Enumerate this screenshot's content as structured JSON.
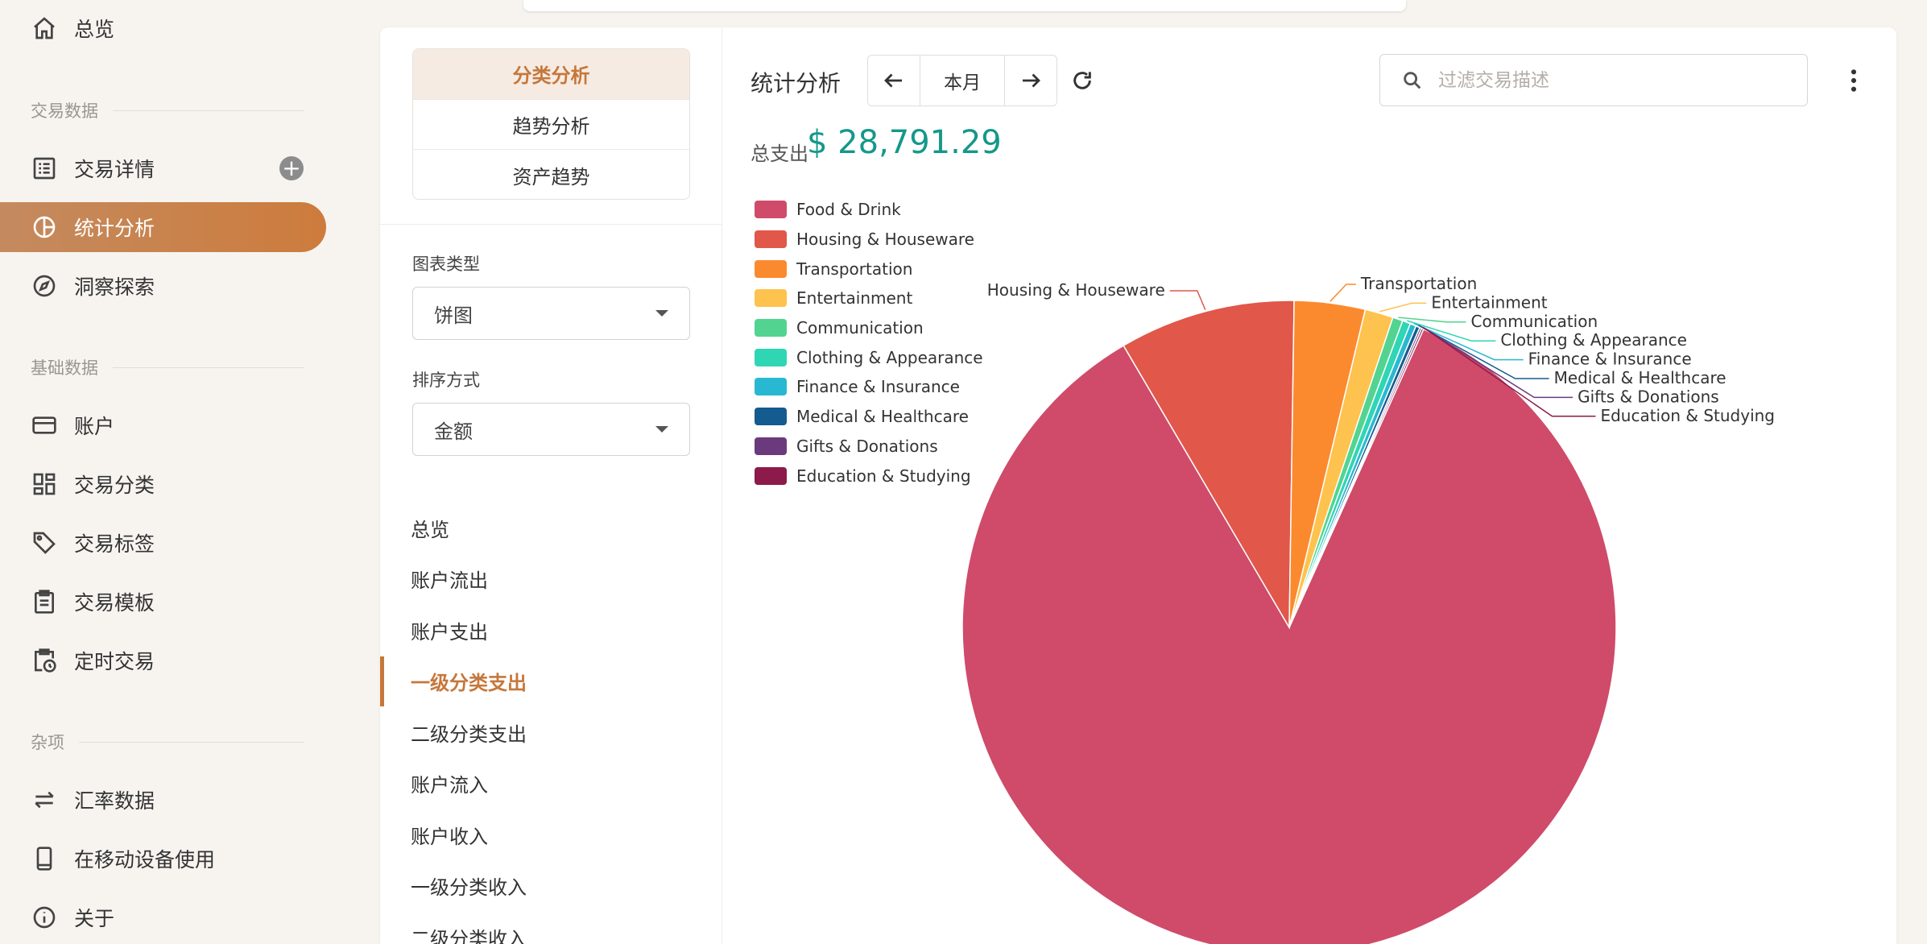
{
  "nav": {
    "overview": "总览",
    "group_transactions": "交易数据",
    "transaction_details": "交易详情",
    "statistics": "统计分析",
    "insights": "洞察探索",
    "group_basic": "基础数据",
    "accounts": "账户",
    "categories": "交易分类",
    "tags": "交易标签",
    "templates": "交易模板",
    "scheduled": "定时交易",
    "group_misc": "杂项",
    "exchange_rates": "汇率数据",
    "mobile": "在移动设备使用",
    "about": "关于"
  },
  "subnav": {
    "tabs": [
      "分类分析",
      "趋势分析",
      "资产趋势"
    ],
    "chart_type_label": "图表类型",
    "chart_type_value": "饼图",
    "sort_label": "排序方式",
    "sort_value": "金额",
    "items": [
      "总览",
      "账户流出",
      "账户支出",
      "一级分类支出",
      "二级分类支出",
      "账户流入",
      "账户收入",
      "一级分类收入",
      "二级分类收入"
    ],
    "active_index": 3
  },
  "content": {
    "title": "统计分析",
    "period": "本月",
    "search_placeholder": "过滤交易描述",
    "total_label": "总支出",
    "total_value": "$ 28,791.29"
  },
  "colors": {
    "accent": "#c6773a",
    "total": "#14988a"
  },
  "chart_data": {
    "type": "pie",
    "categories": [
      "Food & Drink",
      "Housing & Houseware",
      "Transportation",
      "Entertainment",
      "Communication",
      "Clothing & Appearance",
      "Finance & Insurance",
      "Medical & Healthcare",
      "Gifts & Donations",
      "Education & Studying"
    ],
    "values": [
      84.8,
      8.7,
      3.5,
      1.4,
      0.5,
      0.4,
      0.3,
      0.2,
      0.1,
      0.1
    ],
    "colors": [
      "#cf4b69",
      "#e15749",
      "#fb8a2e",
      "#fec24e",
      "#52d490",
      "#2ed6b4",
      "#29b8d2",
      "#145b8f",
      "#6b3a7d",
      "#8c1a4a"
    ],
    "legend": "left"
  }
}
